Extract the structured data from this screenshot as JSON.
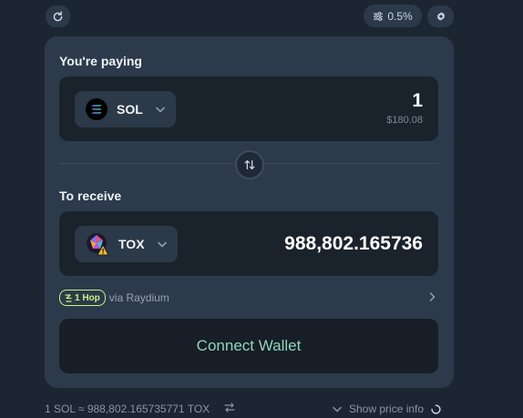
{
  "toolbar": {
    "slippage_label": "0.5%"
  },
  "pay": {
    "label": "You're paying",
    "token": "SOL",
    "amount": "1",
    "usd_value": "$180.08"
  },
  "receive": {
    "label": "To receive",
    "token": "TOX",
    "amount": "988,802.165736"
  },
  "route": {
    "hops_label": "1 Hop",
    "via_label": "via Raydium"
  },
  "actions": {
    "connect_label": "Connect Wallet"
  },
  "footer": {
    "rate_text": "1 SOL ≈ 988,802.165735771 TOX",
    "price_info_label": "Show price info"
  },
  "colors": {
    "accent_green": "#c7f284",
    "connect_text": "#8fd6b8",
    "card_bg": "#2d3a4b",
    "page_bg": "#1c2532"
  }
}
